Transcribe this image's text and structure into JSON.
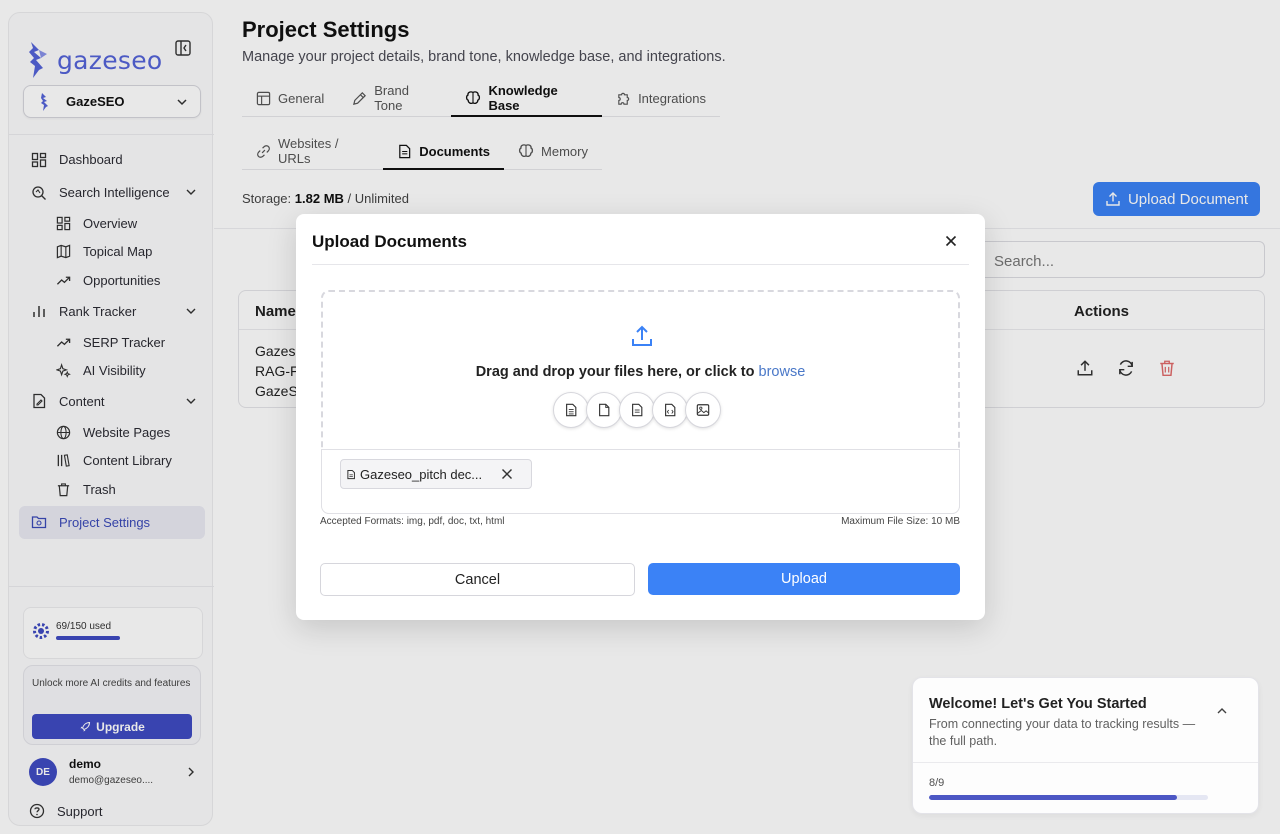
{
  "sidebar": {
    "logo_text": "gazeseo",
    "project_name": "GazeSEO",
    "nav": {
      "dashboard": "Dashboard",
      "search_intelligence": "Search Intelligence",
      "overview": "Overview",
      "topical_map": "Topical Map",
      "opportunities": "Opportunities",
      "rank_tracker": "Rank Tracker",
      "serp_tracker": "SERP Tracker",
      "ai_visibility": "AI Visibility",
      "content": "Content",
      "website_pages": "Website Pages",
      "content_library": "Content Library",
      "trash": "Trash",
      "project_settings": "Project Settings"
    },
    "credits_label": "69/150 used",
    "credits_used": 69,
    "credits_total": 150,
    "upgrade_text": "Unlock more AI credits and features",
    "upgrade_label": "Upgrade",
    "user_initials": "DE",
    "user_name": "demo",
    "user_email": "demo@gazeseo....",
    "support_label": "Support"
  },
  "header": {
    "title": "Project Settings",
    "subtitle": "Manage your project details, brand tone, knowledge base, and integrations."
  },
  "tabs": [
    "General",
    "Brand Tone",
    "Knowledge Base",
    "Integrations"
  ],
  "subtabs": [
    "Websites / URLs",
    "Documents",
    "Memory"
  ],
  "storage": {
    "label": "Storage:",
    "used": "1.82 MB",
    "limit": "/ Unlimited"
  },
  "upload_document_label": "Upload Document",
  "search_placeholder": "Search...",
  "table": {
    "col_name": "Name",
    "col_actions": "Actions",
    "row_lines": [
      "Gazes",
      "RAG-F",
      "GazeS"
    ]
  },
  "modal": {
    "title": "Upload Documents",
    "drop_text": "Drag and drop your files here, or click to",
    "browse": "browse",
    "file_name": "Gazeseo_pitch dec...",
    "accepted": "Accepted Formats: img, pdf, doc, txt, html",
    "max_size": "Maximum File Size: 10 MB",
    "cancel_label": "Cancel",
    "upload_label": "Upload"
  },
  "onboarding": {
    "title": "Welcome! Let's Get You Started",
    "description": "From connecting your data to tracking results — the full path.",
    "progress_label": "8/9",
    "progress_fraction": 0.89
  },
  "colors": {
    "brand": "#3f4bc2",
    "primary_button": "#3b82f6",
    "link": "#4a78c8",
    "danger": "#e06a6a"
  }
}
